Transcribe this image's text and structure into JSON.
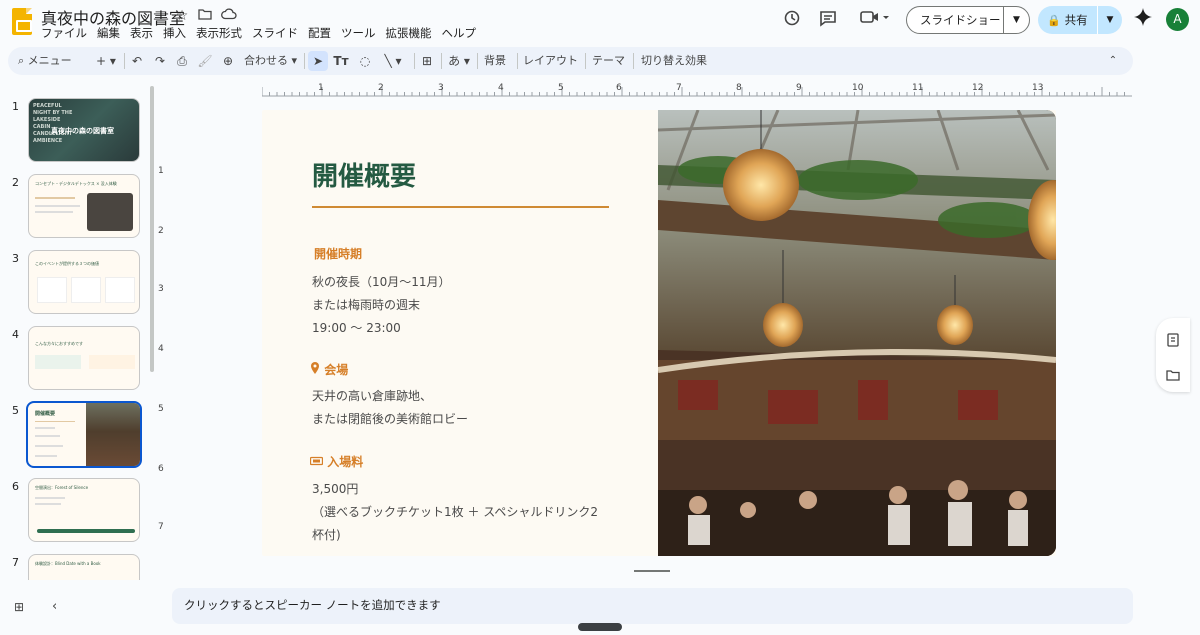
{
  "doc": {
    "title": "真夜中の森の図書室"
  },
  "menus": [
    "ファイル",
    "編集",
    "表示",
    "挿入",
    "表示形式",
    "スライド",
    "配置",
    "ツール",
    "拡張機能",
    "ヘルプ"
  ],
  "header": {
    "slideshow_label": "スライドショー",
    "share_label": "共有",
    "avatar_letter": "A"
  },
  "toolbar": {
    "menu_search": "メニュー",
    "zoom_label": "合わせる",
    "background": "背景",
    "layout": "レイアウト",
    "theme": "テーマ",
    "transition": "切り替え効果"
  },
  "filmstrip": {
    "numbers": [
      "1",
      "2",
      "3",
      "4",
      "5",
      "6",
      "7"
    ],
    "selected_index": 5,
    "thumb1_lines": [
      "PEACEFUL",
      "NIGHT BY THE",
      "LAKESIDE",
      "CABIN",
      "CANDLELIGHT",
      "AMBIENCE"
    ],
    "thumb1_title": "真夜中の森の図書室",
    "thumb2_title": "コンセプト・デジタルデトックス × 没入体験",
    "thumb3_title": "このイベントが提供する３つの価値",
    "thumb4_title": "こんな方々におすすめです",
    "thumb5_title": "開催概要",
    "thumb6_title": "空間演出：Forest of Silence",
    "thumb7_title": "体験設計：Blind Date with a Book"
  },
  "ruler": {
    "h": [
      "1",
      "2",
      "3",
      "4",
      "5",
      "6",
      "7",
      "8",
      "9",
      "10",
      "11",
      "12",
      "13"
    ],
    "v": [
      "1",
      "2",
      "3",
      "4",
      "5",
      "6",
      "7"
    ]
  },
  "slide": {
    "title": "開催概要",
    "period_heading": "開催時期",
    "period_lines": [
      "秋の夜長（10月〜11月）",
      "または梅雨時の週末",
      "19:00 〜 23:00"
    ],
    "venue_heading": "会場",
    "venue_lines": [
      "天井の高い倉庫跡地、",
      "または閉館後の美術館ロビー"
    ],
    "fee_heading": "入場料",
    "fee_lines": [
      "3,500円",
      "（選べるブックチケット1枚 ＋ スペシャルドリンク2",
      "杯付)"
    ]
  },
  "notes": {
    "placeholder": "クリックするとスピーカー ノートを追加できます"
  },
  "colors": {
    "title_green": "#245a42",
    "accent_orange": "#d67f28",
    "select_blue": "#0b57d0"
  }
}
